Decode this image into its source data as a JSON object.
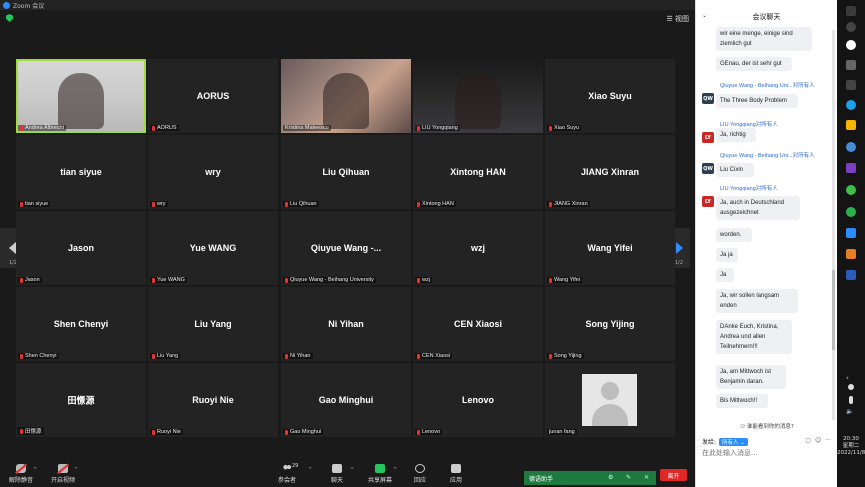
{
  "window": {
    "title": "Zoom 会议",
    "view_label": "视图"
  },
  "tiles": [
    {
      "name": "",
      "label": "Andrea Albrecht",
      "video": "video1",
      "active": true,
      "muted": true
    },
    {
      "name": "AORUS",
      "label": "AORUS",
      "muted": true
    },
    {
      "name": "",
      "label": "Kristina Mateescu",
      "video": "video2",
      "muted": false
    },
    {
      "name": "",
      "label": "LIU Yongqiang",
      "video": "video3",
      "muted": true
    },
    {
      "name": "Xiao Suyu",
      "label": "Xiao Suyu",
      "muted": true
    },
    {
      "name": "tian siyue",
      "label": "tian siyue",
      "muted": true
    },
    {
      "name": "wry",
      "label": "wry",
      "muted": true
    },
    {
      "name": "Liu Qihuan",
      "label": "Liu Qihuan",
      "muted": true
    },
    {
      "name": "Xintong HAN",
      "label": "Xintong HAN",
      "muted": true
    },
    {
      "name": "JIANG Xinran",
      "label": "JIANG Xinran",
      "muted": true
    },
    {
      "name": "Jason",
      "label": "Jason",
      "muted": true
    },
    {
      "name": "Yue WANG",
      "label": "Yue WANG",
      "muted": true
    },
    {
      "name": "Qiuyue Wang -...",
      "label": "Qiuyue Wang - Beihang University",
      "muted": true
    },
    {
      "name": "wzj",
      "label": "wzj",
      "muted": true
    },
    {
      "name": "Wang Yifei",
      "label": "Wang Yifei",
      "muted": true
    },
    {
      "name": "Shen Chenyi",
      "label": "Shen Chenyi",
      "muted": true
    },
    {
      "name": "Liu Yang",
      "label": "Liu Yang",
      "muted": true
    },
    {
      "name": "Ni Yihan",
      "label": "Ni Yihan",
      "muted": true
    },
    {
      "name": "CEN Xiaosi",
      "label": "CEN Xiaosi",
      "muted": true
    },
    {
      "name": "Song Yijing",
      "label": "Song Yijing",
      "muted": true
    },
    {
      "name": "田憬源",
      "label": "田憬源",
      "muted": true
    },
    {
      "name": "Ruoyi Nie",
      "label": "Ruoyi Nie",
      "muted": true
    },
    {
      "name": "Gao Minghui",
      "label": "Gao Minghui",
      "muted": true
    },
    {
      "name": "Lenovo",
      "label": "Lenovo",
      "muted": true
    },
    {
      "name": "",
      "label": "junan fang",
      "avatar": true,
      "muted": false
    }
  ],
  "pager": {
    "left": "1/2",
    "right": "1/2"
  },
  "toolbar": {
    "unmute": "解除静音",
    "start_video": "开启视频",
    "participants": "参会者",
    "participants_count": "29",
    "chat": "聊天",
    "share": "共享屏幕",
    "react": "回应",
    "apps": "应用",
    "helper": "德语助手",
    "leave": "离开"
  },
  "chat": {
    "title": "会议聊天",
    "messages": [
      {
        "type": "bubble",
        "text": "wir eine menge, einige sind ziemlich gut"
      },
      {
        "type": "bubble",
        "text": "GEnau, der ist sehr gut"
      },
      {
        "type": "sender",
        "from": "Qiuyue Wang - Beihang Uni...",
        "to": "对所有人",
        "avatar": "QW"
      },
      {
        "type": "bubble",
        "text": "The Three Body Problem"
      },
      {
        "type": "sender",
        "from": "LIU Yongqiang",
        "to": "对所有人",
        "avatar": "LY"
      },
      {
        "type": "bubble",
        "text": "Ja, richtig"
      },
      {
        "type": "sender",
        "from": "Qiuyue Wang - Beihang Uni...",
        "to": "对所有人",
        "avatar": "QW"
      },
      {
        "type": "bubble",
        "text": "Liu Cixin"
      },
      {
        "type": "sender",
        "from": "LIU Yongqiang",
        "to": "对所有人",
        "avatar": "LY"
      },
      {
        "type": "bubble",
        "text": "Ja, auch in Deutschland ausgezeichnet"
      },
      {
        "type": "bubble",
        "text": "worden."
      },
      {
        "type": "bubble",
        "text": "Ja ja"
      },
      {
        "type": "bubble",
        "text": "Ja"
      },
      {
        "type": "bubble",
        "text": "Ja, wir sollen langsam enden"
      },
      {
        "type": "bubble",
        "text": "DAnke Euch, Kristina, Andrea und allen Teilnehmern!!!"
      },
      {
        "type": "bubble",
        "text": "Ja, am Mittwoch ist Benjamin daran."
      },
      {
        "type": "bubble",
        "text": "Bis Mittwoch!!"
      }
    ],
    "unread_note": "谁能看到你的消息?",
    "send_to_label": "发给:",
    "send_to_value": "所有人",
    "input_placeholder": "在此处输入消息..."
  },
  "clock": {
    "time": "20:30",
    "weekday": "星期二",
    "date": "2022/11/8"
  }
}
